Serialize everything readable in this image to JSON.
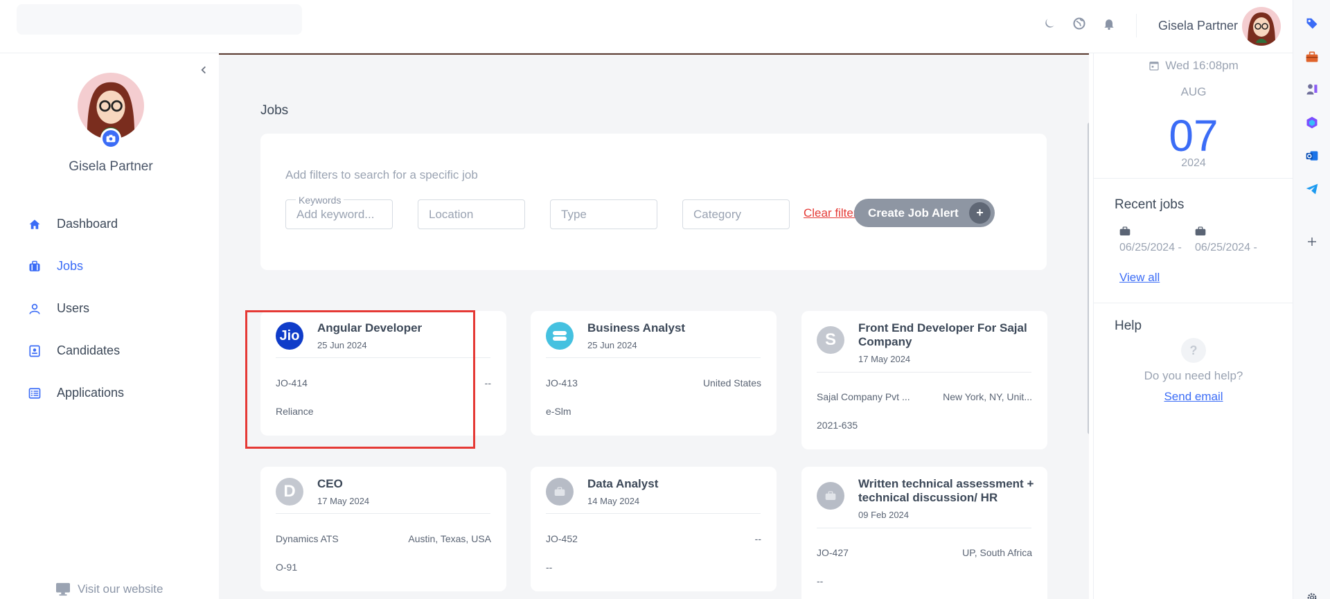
{
  "topbar": {
    "username": "Gisela Partner",
    "icons": [
      "moon-icon",
      "globe-icon",
      "bell-icon"
    ]
  },
  "sidebar": {
    "profile_name": "Gisela Partner",
    "nav": [
      {
        "label": "Dashboard",
        "icon": "home-icon",
        "active": false
      },
      {
        "label": "Jobs",
        "icon": "briefcase-icon",
        "active": true
      },
      {
        "label": "Users",
        "icon": "user-icon",
        "active": false
      },
      {
        "label": "Candidates",
        "icon": "id-card-icon",
        "active": false
      },
      {
        "label": "Applications",
        "icon": "list-icon",
        "active": false
      }
    ],
    "visit_label": "Visit our website"
  },
  "main": {
    "section_title": "Jobs",
    "filters": {
      "hint": "Add filters to search for a specific job",
      "keywords_legend": "Keywords",
      "keywords_placeholder": "Add keyword...",
      "location_placeholder": "Location",
      "type_placeholder": "Type",
      "category_placeholder": "Category",
      "clear_label": "Clear filters",
      "alert_label": "Create Job Alert",
      "alert_plus": "+"
    },
    "jobs": [
      {
        "title": "Angular Developer",
        "date": "25 Jun 2024",
        "code": "JO-414",
        "location": "--",
        "company": "Reliance",
        "logo_text": "Jio",
        "logo_color": "#0f3cc9"
      },
      {
        "title": "Business Analyst",
        "date": "25 Jun 2024",
        "code": "JO-413",
        "location": "United States",
        "company": "e-Slm",
        "logo_text": "",
        "logo_color": "#45c1e0"
      },
      {
        "title": "Front End Developer For Sajal Company",
        "date": "17 May 2024",
        "code": "Sajal Company Pvt ...",
        "location": "New York, NY, Unit...",
        "company": "2021-635",
        "logo_text": "S",
        "logo_color": "#c4c8d0"
      },
      {
        "title": "CEO",
        "date": "17 May 2024",
        "code": "Dynamics ATS",
        "location": "Austin, Texas, USA",
        "company": "O-91",
        "logo_text": "D",
        "logo_color": "#c4c8d0"
      },
      {
        "title": "Data Analyst",
        "date": "14 May 2024",
        "code": "JO-452",
        "location": "--",
        "company": "--",
        "logo_text": "",
        "logo_color": "#b7bcc6"
      },
      {
        "title": "Written technical assessment + technical discussion/ HR",
        "date": "09 Feb 2024",
        "code": "JO-427",
        "location": "UP, South Africa",
        "company": "--",
        "logo_text": "",
        "logo_color": "#b7bcc6"
      }
    ]
  },
  "right_panel": {
    "datetime": "Wed 16:08pm",
    "month": "AUG",
    "day": "07",
    "year": "2024",
    "recent_heading": "Recent jobs",
    "recent": [
      "06/25/2024 -",
      "06/25/2024 -"
    ],
    "view_all": "View all",
    "help_heading": "Help",
    "help_icon": "?",
    "help_question": "Do you need help?",
    "send_email": "Send email"
  },
  "rail": {
    "icons": [
      "tag-icon",
      "toolbox-icon",
      "chess-icon",
      "copilot-icon",
      "outlook-icon",
      "telegram-icon",
      "plus-icon",
      "gear-icon"
    ],
    "colors": {
      "accent": "#3b6cf6",
      "danger": "#e53935"
    }
  }
}
